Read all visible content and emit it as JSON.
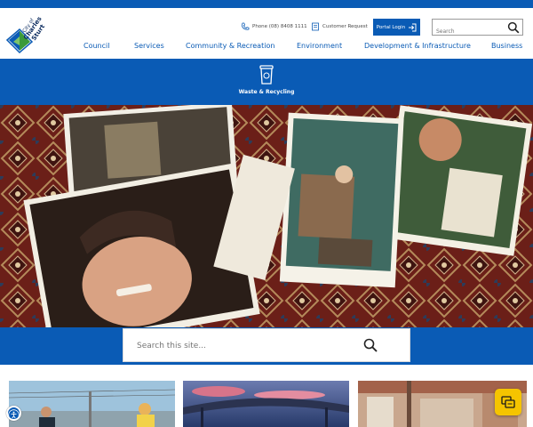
{
  "brand": {
    "logo_text": "City of Charles Sturt",
    "primary_color": "#0a5bb5",
    "accent_green": "#3a9a3a",
    "chat_color": "#f5c400"
  },
  "utility": {
    "phone_label": "Phone (08) 8408 1111",
    "phone_icon": "phone-icon",
    "request_label": "Customer Request",
    "request_icon": "form-icon",
    "portal_label": "Portal Login",
    "portal_icon": "login-arrow-icon"
  },
  "header_search": {
    "placeholder": "Search",
    "icon": "search-icon"
  },
  "nav": {
    "items": [
      {
        "label": "Council"
      },
      {
        "label": "Services"
      },
      {
        "label": "Community & Recreation"
      },
      {
        "label": "Environment"
      },
      {
        "label": "Development & Infrastructure"
      },
      {
        "label": "Business"
      }
    ]
  },
  "quick_links": {
    "items": [
      {
        "label": "Waste & Recycling",
        "icon": "waste-bin-icon"
      }
    ]
  },
  "hero": {
    "image_subject": "scattered family photographs on a patterned rug"
  },
  "site_search": {
    "placeholder": "Search this site...",
    "icon": "search-icon"
  },
  "cards": {
    "count": 3
  },
  "floating": {
    "accessibility_icon": "accessibility-icon",
    "chat_icon": "chat-bubbles-icon"
  }
}
